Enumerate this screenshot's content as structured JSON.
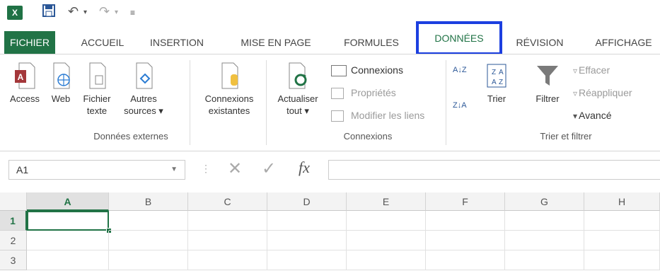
{
  "app": {
    "icon_label": "X"
  },
  "tabs": [
    {
      "label": "FICHIER"
    },
    {
      "label": "ACCUEIL"
    },
    {
      "label": "INSERTION"
    },
    {
      "label": "MISE EN PAGE"
    },
    {
      "label": "FORMULES"
    },
    {
      "label": "DONNÉES"
    },
    {
      "label": "RÉVISION"
    },
    {
      "label": "AFFICHAGE"
    }
  ],
  "ribbon": {
    "external": {
      "access": "Access",
      "web": "Web",
      "text_line1": "Fichier",
      "text_line2": "texte",
      "other_line1": "Autres",
      "other_line2": "sources ▾",
      "group_label": "Données externes"
    },
    "existing": {
      "line1": "Connexions",
      "line2": "existantes"
    },
    "connections": {
      "refresh_line1": "Actualiser",
      "refresh_line2": "tout ▾",
      "connections": "Connexions",
      "properties": "Propriétés",
      "edit_links": "Modifier les liens",
      "group_label": "Connexions"
    },
    "sort_filter": {
      "sort_az": "A↓Z",
      "sort_za": "Z↓A",
      "sort": "Trier",
      "filter": "Filtrer",
      "clear": "Effacer",
      "reapply": "Réappliquer",
      "advanced": "Avancé",
      "group_label": "Trier et filtrer"
    }
  },
  "formula_bar": {
    "name_box": "A1",
    "fx": "fx",
    "formula": ""
  },
  "grid": {
    "columns": [
      "A",
      "B",
      "C",
      "D",
      "E",
      "F",
      "G",
      "H"
    ],
    "rows": [
      "1",
      "2",
      "3"
    ]
  },
  "colors": {
    "accent": "#217346",
    "highlight_border": "#1c3fe0"
  }
}
